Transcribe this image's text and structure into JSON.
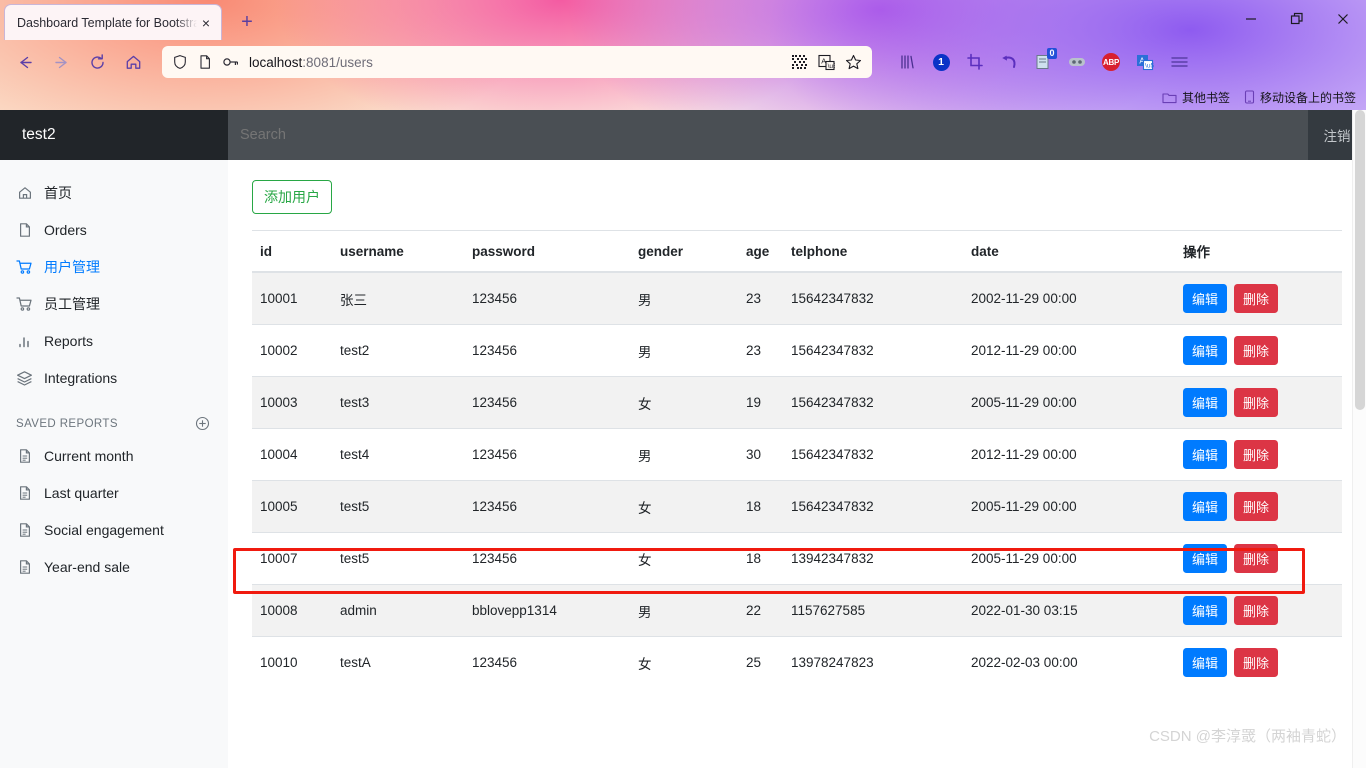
{
  "browser": {
    "tab": {
      "title": "Dashboard Template for Bootstra",
      "close_label": "×"
    },
    "new_tab_label": "+",
    "window_controls": {
      "minimize": "—",
      "maximize": "❐",
      "close": "✕"
    },
    "nav": {
      "back_icon": "back-arrow-icon",
      "forward_icon": "forward-arrow-icon",
      "reload_icon": "reload-icon",
      "home_icon": "home-icon"
    },
    "url": {
      "host": "localhost",
      "rest": ":8081/users",
      "full": "localhost:8081/users"
    },
    "url_icons": [
      "shield-icon",
      "page-icon",
      "key-icon"
    ],
    "url_right_icons": [
      "qr-code-icon",
      "translate-icon",
      "bookmark-star-icon"
    ],
    "extensions": [
      {
        "name": "library-icon",
        "label": ""
      },
      {
        "name": "counter-badge-icon",
        "label": "1"
      },
      {
        "name": "crop-icon",
        "label": ""
      },
      {
        "name": "undo-arrow-icon",
        "label": ""
      },
      {
        "name": "notes-icon",
        "label": "0"
      },
      {
        "name": "dots-extension-icon",
        "label": ""
      },
      {
        "name": "adblock-plus-icon",
        "label": "ABP"
      },
      {
        "name": "translate-extension-icon",
        "label": ""
      },
      {
        "name": "hamburger-menu-icon",
        "label": "≡"
      }
    ],
    "bookmarks": [
      {
        "icon": "folder-icon",
        "label": "其他书签"
      },
      {
        "icon": "mobile-icon",
        "label": "移动设备上的书签"
      }
    ]
  },
  "app": {
    "brand": "test2",
    "topnav": {
      "search_placeholder": "Search",
      "logout_label": "注销"
    },
    "sidebar": {
      "items": [
        {
          "label": "首页",
          "icon": "home-icon",
          "active": false
        },
        {
          "label": "Orders",
          "icon": "file-icon",
          "active": false
        },
        {
          "label": "用户管理",
          "icon": "shopping-cart-icon",
          "active": true
        },
        {
          "label": "员工管理",
          "icon": "shopping-cart-icon",
          "active": false
        },
        {
          "label": "Reports",
          "icon": "bar-chart-icon",
          "active": false
        },
        {
          "label": "Integrations",
          "icon": "layers-icon",
          "active": false
        }
      ],
      "saved_reports_heading": "SAVED REPORTS",
      "saved_reports_add_icon": "plus-circle-icon",
      "saved_reports": [
        {
          "label": "Current month",
          "icon": "file-text-icon"
        },
        {
          "label": "Last quarter",
          "icon": "file-text-icon"
        },
        {
          "label": "Social engagement",
          "icon": "file-text-icon"
        },
        {
          "label": "Year-end sale",
          "icon": "file-text-icon"
        }
      ]
    },
    "main": {
      "add_user_button": "添加用户",
      "table": {
        "headers": [
          "id",
          "username",
          "password",
          "gender",
          "age",
          "telphone",
          "date",
          "操作"
        ],
        "row_actions": {
          "edit": "编辑",
          "delete": "删除"
        },
        "rows": [
          {
            "id": "10001",
            "username": "张三",
            "password": "123456",
            "gender": "男",
            "age": "23",
            "telphone": "15642347832",
            "date": "2002-11-29 00:00"
          },
          {
            "id": "10002",
            "username": "test2",
            "password": "123456",
            "gender": "男",
            "age": "23",
            "telphone": "15642347832",
            "date": "2012-11-29 00:00"
          },
          {
            "id": "10003",
            "username": "test3",
            "password": "123456",
            "gender": "女",
            "age": "19",
            "telphone": "15642347832",
            "date": "2005-11-29 00:00"
          },
          {
            "id": "10004",
            "username": "test4",
            "password": "123456",
            "gender": "男",
            "age": "30",
            "telphone": "15642347832",
            "date": "2012-11-29 00:00"
          },
          {
            "id": "10005",
            "username": "test5",
            "password": "123456",
            "gender": "女",
            "age": "18",
            "telphone": "15642347832",
            "date": "2005-11-29 00:00"
          },
          {
            "id": "10007",
            "username": "test5",
            "password": "123456",
            "gender": "女",
            "age": "18",
            "telphone": "13942347832",
            "date": "2005-11-29 00:00"
          },
          {
            "id": "10008",
            "username": "admin",
            "password": "bblovepp1314",
            "gender": "男",
            "age": "22",
            "telphone": "1157627585",
            "date": "2022-01-30 03:15"
          },
          {
            "id": "10010",
            "username": "testA",
            "password": "123456",
            "gender": "女",
            "age": "25",
            "telphone": "13978247823",
            "date": "2022-02-03 00:00",
            "highlighted": true
          }
        ]
      }
    },
    "watermark": "CSDN @李淳罭（两袖青蛇）"
  },
  "colors": {
    "accent_blue": "#007bff",
    "danger_red": "#dc3545",
    "success_green": "#28a745",
    "sidebar_bg": "#f8f9fa",
    "brand_bg": "#212529",
    "topnav_bg": "#4a4f54",
    "highlight_box": "#f01a0f"
  }
}
